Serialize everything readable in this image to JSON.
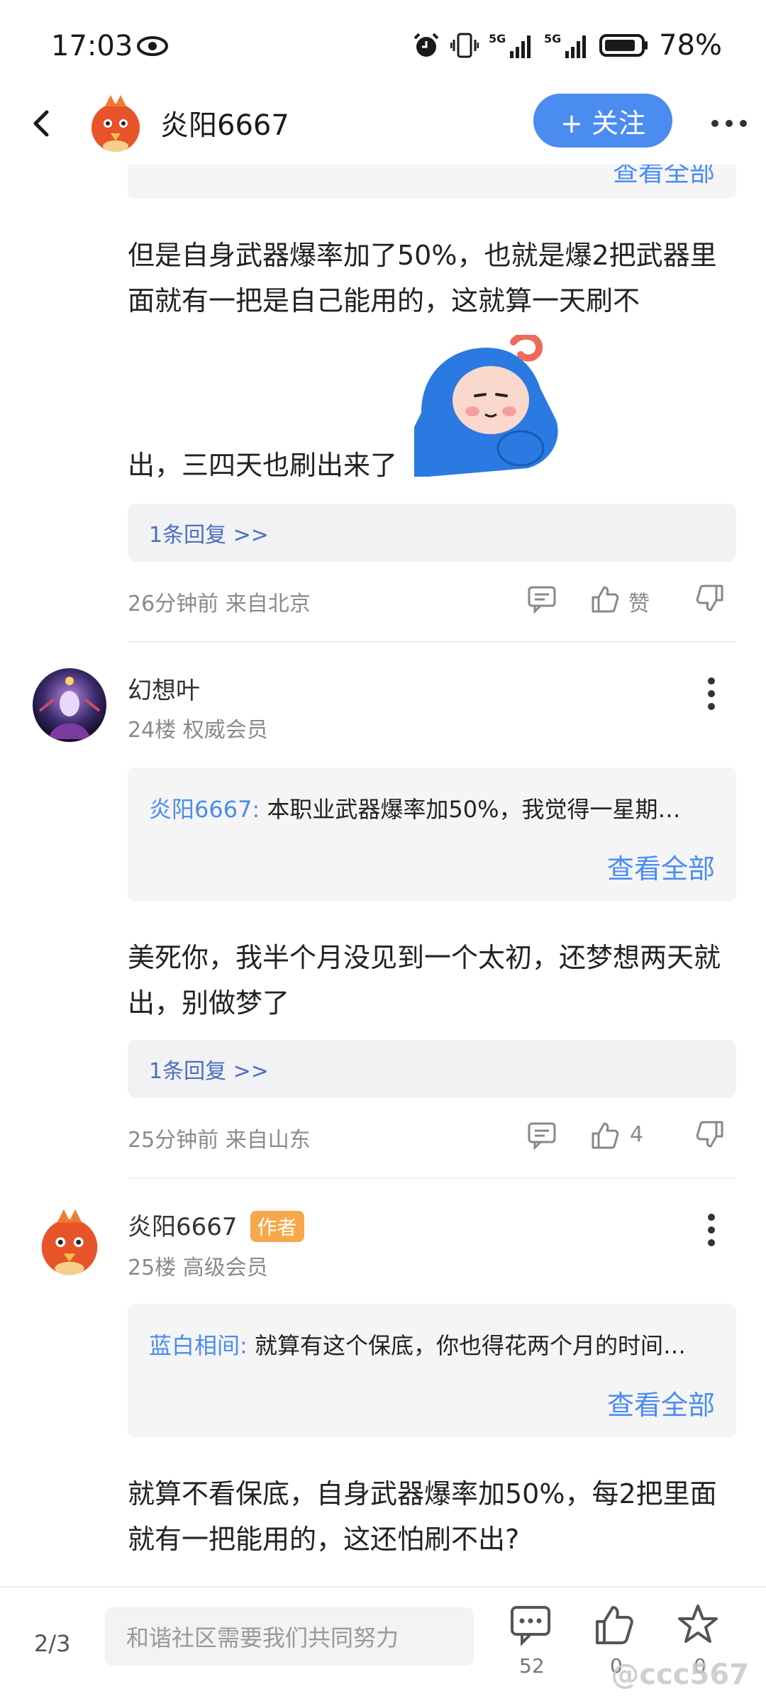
{
  "status_bar": {
    "time": "17:03",
    "battery": "78%",
    "network_1": "5G",
    "network_2": "5G"
  },
  "header": {
    "username": "炎阳6667",
    "follow_label": "+ 关注"
  },
  "top_card": {
    "view_all": "查看全部"
  },
  "comment_1": {
    "text_1": "但是自身武器爆率加了50%，也就是爆2把武器里面就有一把是自己能用的，这就算一天刷不",
    "text_2": "出，三四天也刷出来了",
    "reply_count_label": "1条回复 >>",
    "meta": "26分钟前 来自北京",
    "like_label": "赞"
  },
  "comment_2": {
    "author": "幻想叶",
    "floor": "24楼 权威会员",
    "quote_author": "炎阳6667:",
    "quote_text": "本职业武器爆率加50%，我觉得一星期…",
    "view_all": "查看全部",
    "text": "美死你，我半个月没见到一个太初，还梦想两天就出，别做梦了",
    "reply_count_label": "1条回复 >>",
    "meta": "25分钟前 来自山东",
    "like_count": "4"
  },
  "comment_3": {
    "author": "炎阳6667",
    "author_badge": "作者",
    "floor": "25楼 高级会员",
    "quote_author": "蓝白相间:",
    "quote_text": "就算有这个保底，你也得花两个月的时间…",
    "view_all": "查看全部",
    "text": "就算不看保底，自身武器爆率加50%，每2把里面就有一把能用的，这还怕刷不出?"
  },
  "bottom_bar": {
    "page_indicator": "2/3",
    "input_placeholder": "和谐社区需要我们共同努力",
    "comment_count": "52",
    "like_count": "0",
    "fav_count": "0",
    "watermark": "@ccc567"
  },
  "colors": {
    "accent": "#4a8cf0",
    "author_badge": "#f6a84a",
    "reply_link": "#4a6fbf"
  }
}
